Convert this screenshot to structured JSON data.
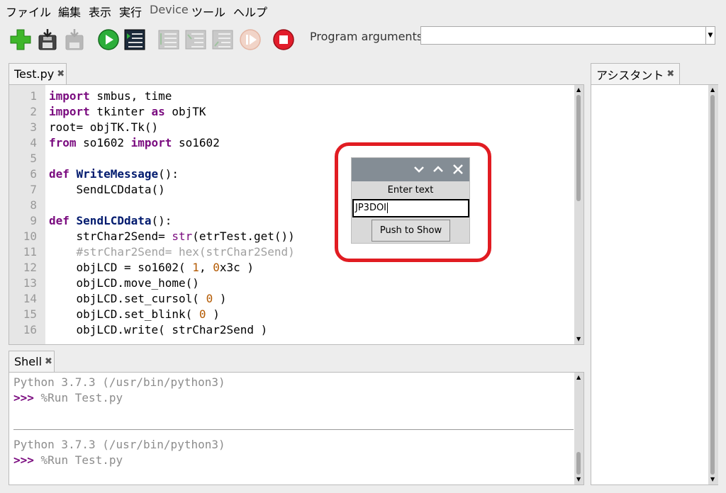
{
  "menu": {
    "items": [
      {
        "label": "ファイル"
      },
      {
        "label": "編集"
      },
      {
        "label": "表示"
      },
      {
        "label": "実行"
      },
      {
        "label": "Device"
      },
      {
        "label": "ツール"
      },
      {
        "label": "ヘルプ"
      }
    ]
  },
  "toolbar": {
    "icons": [
      "new-file-icon",
      "save-icon",
      "save-disabled-icon",
      "run-icon",
      "debug-icon",
      "step-over-icon",
      "step-into-icon",
      "step-out-icon",
      "resume-icon",
      "stop-icon"
    ],
    "args_label": "Program arguments:",
    "args_value": ""
  },
  "editor": {
    "tab_label": "Test.py",
    "lines": [
      "1",
      "2",
      "3",
      "4",
      "5",
      "6",
      "7",
      "8",
      "9",
      "10",
      "11",
      "12",
      "13",
      "14",
      "15",
      "16"
    ],
    "code": {
      "l1_kw": "import",
      "l1_rest": " smbus, time",
      "l2_kw": "import",
      "l2_mid": " tkinter ",
      "l2_kw2": "as",
      "l2_rest": " objTK",
      "l3": "root= objTK.Tk()",
      "l4_kw": "from",
      "l4_mid": " so1602 ",
      "l4_kw2": "import",
      "l4_rest": " so1602",
      "l6_kw": "def",
      "l6_fn": " WriteMessage",
      "l6_rest": "():",
      "l7": "    SendLCDdata()",
      "l9_kw": "def",
      "l9_fn": " SendLCDdata",
      "l9_rest": "():",
      "l10_a": "    strChar2Send= ",
      "l10_bi": "str",
      "l10_b": "(etrTest.get())",
      "l11": "    #strChar2Send= hex(strChar2Send)",
      "l12_a": "    objLCD = so1602( ",
      "l12_n1": "1",
      "l12_b": ", ",
      "l12_n2": "0",
      "l12_c": "x3c )",
      "l13": "    objLCD.move_home()",
      "l14_a": "    objLCD.set_cursol( ",
      "l14_n": "0",
      "l14_b": " )",
      "l15_a": "    objLCD.set_blink( ",
      "l15_n": "0",
      "l15_b": " )",
      "l16": "    objLCD.write( strChar2Send )"
    }
  },
  "shell": {
    "tab_label": "Shell",
    "version1": "Python 3.7.3 (/usr/bin/python3)",
    "prompt1": ">>>",
    "cmd1": " %Run Test.py",
    "version2": "Python 3.7.3 (/usr/bin/python3)",
    "prompt2": ">>>",
    "cmd2": " %Run Test.py"
  },
  "assistant": {
    "tab_label": "アシスタント"
  },
  "dialog": {
    "label": "Enter text",
    "entry_value": "JP3DOI",
    "button_label": "Push to Show",
    "highlight_color": "#e11c22"
  }
}
